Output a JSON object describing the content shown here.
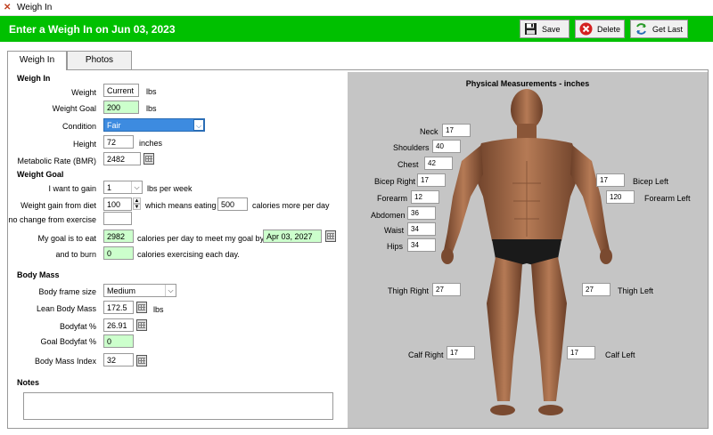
{
  "window": {
    "title": "Weigh In"
  },
  "header": {
    "title": "Enter a Weigh In on Jun 03, 2023",
    "save_label": "Save",
    "delete_label": "Delete",
    "getlast_label": "Get Last"
  },
  "tabs": [
    {
      "label": "Weigh In"
    },
    {
      "label": "Photos"
    }
  ],
  "weigh_in": {
    "section_title": "Weigh In",
    "weight_label": "Weight",
    "weight_value": "Current",
    "weight_unit": "lbs",
    "weight_goal_label": "Weight Goal",
    "weight_goal_value": "200",
    "weight_goal_unit": "lbs",
    "condition_label": "Condition",
    "condition_value": "Fair",
    "height_label": "Height",
    "height_value": "72",
    "height_unit": "inches",
    "bmr_label": "Metabolic Rate (BMR)",
    "bmr_value": "2482"
  },
  "weight_goal": {
    "section_title": "Weight Goal",
    "want_label": "I want to gain",
    "want_value": "1",
    "want_unit": "lbs per week",
    "diet_label": "Weight gain from diet",
    "diet_value": "100",
    "diet_mid": "which means eating",
    "eating_value": "500",
    "eating_unit": "calories more per day",
    "exercise_label": "no change from exercise",
    "exercise_value": "",
    "eat_label": "My goal is to eat",
    "eat_value": "2982",
    "eat_mid": "calories per day to meet my goal by",
    "goal_date": "Apr 03, 2027",
    "burn_label": "and to burn",
    "burn_value": "0",
    "burn_unit": "calories exercising each day."
  },
  "body_mass": {
    "section_title": "Body Mass",
    "frame_label": "Body frame size",
    "frame_value": "Medium",
    "lean_label": "Lean Body Mass",
    "lean_value": "172.5",
    "lean_unit": "lbs",
    "bodyfat_label": "Bodyfat %",
    "bodyfat_value": "26.91",
    "goal_bodyfat_label": "Goal Bodyfat %",
    "goal_bodyfat_value": "0",
    "bmi_label": "Body Mass Index",
    "bmi_value": "32"
  },
  "notes": {
    "section_title": "Notes",
    "value": ""
  },
  "measurements": {
    "title": "Physical Measurements - inches",
    "neck_label": "Neck",
    "neck": "17",
    "shoulders_label": "Shoulders",
    "shoulders": "40",
    "chest_label": "Chest",
    "chest": "42",
    "bicep_right_label": "Bicep Right",
    "bicep_right": "17",
    "bicep_left_label": "Bicep Left",
    "bicep_left": "17",
    "forearm_label": "Forearm",
    "forearm": "12",
    "forearm_left_label": "Forearm Left",
    "forearm_left": "120",
    "abdomen_label": "Abdomen",
    "abdomen": "36",
    "waist_label": "Waist",
    "waist": "34",
    "hips_label": "Hips",
    "hips": "34",
    "thigh_right_label": "Thigh Right",
    "thigh_right": "27",
    "thigh_left_label": "Thigh Left",
    "thigh_left": "27",
    "calf_right_label": "Calf Right",
    "calf_right": "17",
    "calf_left_label": "Calf Left",
    "calf_left": "17"
  },
  "colors": {
    "header_bg": "#00c000",
    "input_green": "#ccffcc",
    "focus_blue": "#3d8be0",
    "figure_bg": "#c5c5c5"
  },
  "icons": {
    "save": "floppy-disk-icon",
    "delete": "red-x-circle-icon",
    "getlast": "refresh-arrows-icon",
    "calendar": "calendar-icon"
  }
}
